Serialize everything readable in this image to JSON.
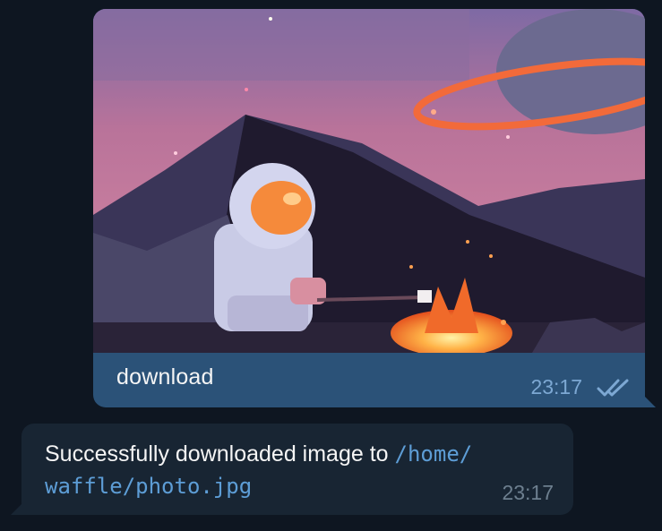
{
  "messages": [
    {
      "direction": "outgoing",
      "type": "photo",
      "image_description_icon": "pixel-art-astronaut-campfire-image",
      "caption": "download",
      "time": "23:17",
      "status": "read"
    },
    {
      "direction": "incoming",
      "type": "text",
      "text_prefix": "Successfully downloaded image to ",
      "path_line1": "/home/",
      "path_line2": "waffle/photo.jpg",
      "time": "23:17"
    }
  ],
  "colors": {
    "background": "#0e1621",
    "outgoing_bubble": "#2b5278",
    "incoming_bubble": "#182533",
    "link": "#6ab3f3"
  }
}
